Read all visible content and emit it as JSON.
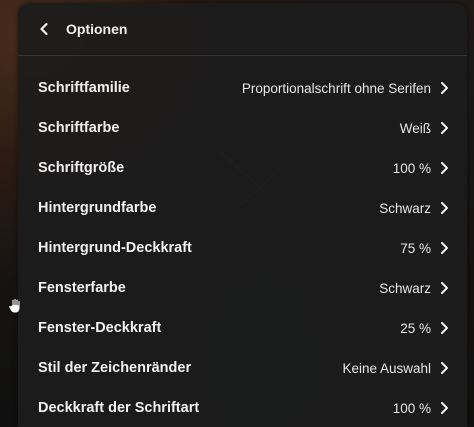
{
  "header": {
    "title": "Optionen"
  },
  "menu": {
    "items": [
      {
        "label": "Schriftfamilie",
        "value": "Proportionalschrift ohne Serifen"
      },
      {
        "label": "Schriftfarbe",
        "value": "Weiß"
      },
      {
        "label": "Schriftgröße",
        "value": "100 %"
      },
      {
        "label": "Hintergrundfarbe",
        "value": "Schwarz"
      },
      {
        "label": "Hintergrund-Deckkraft",
        "value": "75 %"
      },
      {
        "label": "Fensterfarbe",
        "value": "Schwarz"
      },
      {
        "label": "Fenster-Deckkraft",
        "value": "25 %"
      },
      {
        "label": "Stil der Zeichenränder",
        "value": "Keine Auswahl"
      },
      {
        "label": "Deckkraft der Schriftart",
        "value": "100 %"
      }
    ]
  },
  "icons": {
    "back": "chevron-left-icon",
    "item": "chevron-right-icon",
    "cursor": "hand-cursor-icon"
  },
  "colors": {
    "panel_bg": "#1c1c1c",
    "text": "#f1f1f1"
  }
}
